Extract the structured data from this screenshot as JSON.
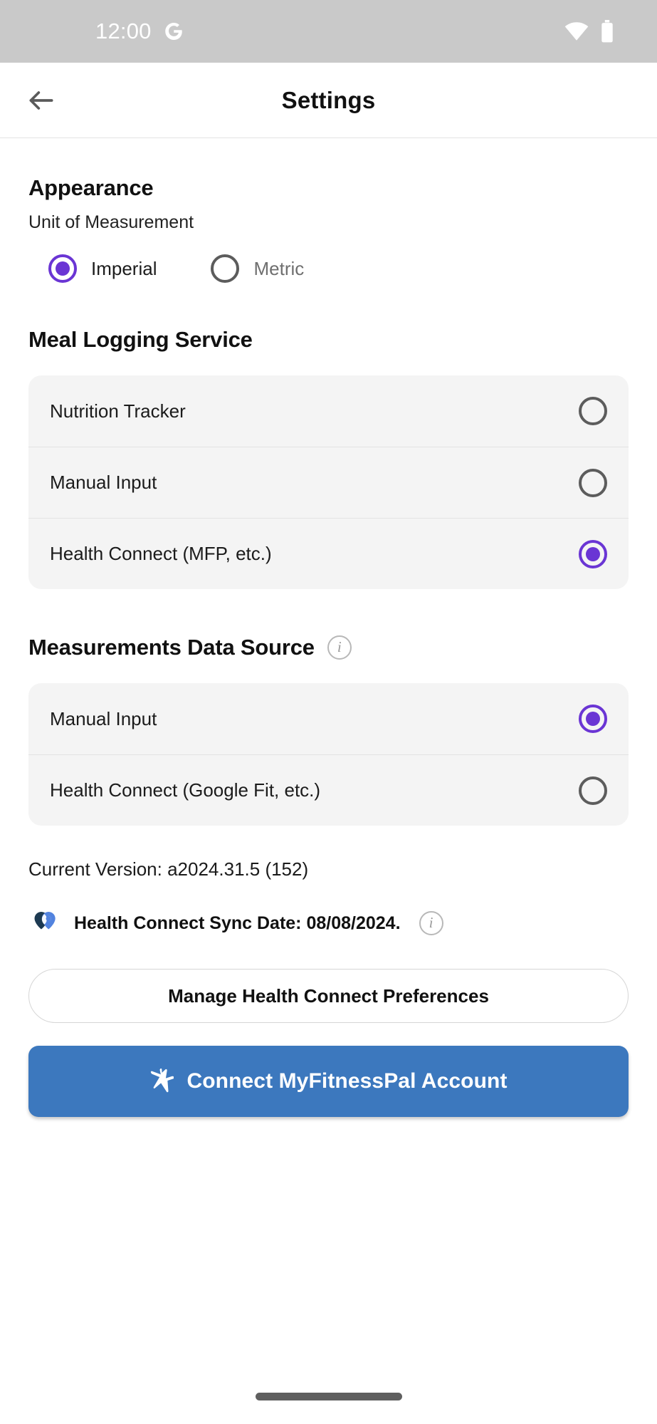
{
  "status_bar": {
    "time": "12:00",
    "google_icon": "google-g-icon",
    "wifi_icon": "wifi-icon",
    "battery_icon": "battery-icon"
  },
  "app_bar": {
    "back_icon": "back-arrow-icon",
    "title": "Settings"
  },
  "appearance": {
    "heading": "Appearance",
    "sub_label": "Unit of Measurement",
    "options": [
      {
        "label": "Imperial",
        "selected": true
      },
      {
        "label": "Metric",
        "selected": false
      }
    ]
  },
  "meal_logging": {
    "heading": "Meal Logging Service",
    "options": [
      {
        "label": "Nutrition Tracker",
        "selected": false
      },
      {
        "label": "Manual Input",
        "selected": false
      },
      {
        "label": "Health Connect (MFP, etc.)",
        "selected": true
      }
    ]
  },
  "measurements": {
    "heading": "Measurements Data Source",
    "info_icon": "info-icon",
    "options": [
      {
        "label": "Manual Input",
        "selected": true
      },
      {
        "label": "Health Connect (Google Fit, etc.)",
        "selected": false
      }
    ]
  },
  "footer": {
    "version_text": "Current Version: a2024.31.5 (152)",
    "sync_logo": "health-connect-logo-icon",
    "sync_text": "Health Connect Sync Date: 08/08/2024.",
    "sync_info_icon": "info-icon",
    "manage_button": "Manage Health Connect Preferences",
    "connect_button": "Connect MyFitnessPal Account",
    "connect_button_icon": "myfitnesspal-icon"
  },
  "nav_bar": {
    "home_indicator": "home-indicator"
  },
  "colors": {
    "accent_purple": "#6A35D4",
    "primary_blue": "#3C78BE",
    "card_background": "#f4f4f4",
    "status_bar": "#c9c9c9",
    "hc_logo_navy": "#1d3a52",
    "hc_logo_blue": "#5283df"
  }
}
